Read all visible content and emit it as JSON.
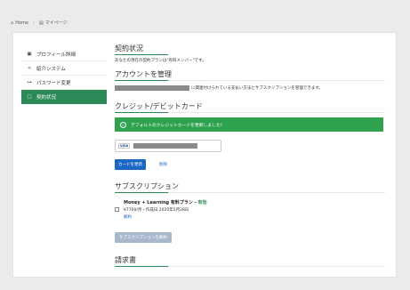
{
  "breadcrumb": {
    "home": "Home",
    "separator": "›",
    "current": "マイページ"
  },
  "sidebar": {
    "items": [
      {
        "icon": "▣",
        "label": "プロフィール詳細"
      },
      {
        "icon": "<",
        "label": "紹介システム"
      },
      {
        "icon": "⊶",
        "label": "パスワード変更"
      },
      {
        "icon": "▢",
        "label": "契約状況"
      }
    ]
  },
  "contract": {
    "title": "契約状況",
    "plan_text": "あなたの現在の契約プランは\"有料メンバー\"です。"
  },
  "account": {
    "title": "アカウントを管理",
    "description": "に関連付けられている支払い方法とサブスクリプションを管理できます。"
  },
  "credit": {
    "title": "クレジット/デビットカード",
    "alert_icon": "✓",
    "alert_text": "デフォルトのクレジットカードを更新しました！",
    "card_brand": "VISA",
    "update_button": "カードを更新",
    "delete_link": "削除"
  },
  "subscription": {
    "title": "サブスクリプション",
    "name": "Money + Learning 有料プラン",
    "status_separator": " - ",
    "status": "有効",
    "detail": "¥7700/月・作成日 2020年5月28日",
    "cancel_link": "解約",
    "cancel_button": "サブスクリプションを解約"
  },
  "invoice": {
    "title": "請求書"
  },
  "colors": {
    "accent": "#2c8a58",
    "alert": "#2fa24e",
    "primary": "#1d67c4",
    "disabled": "#a7b8cc"
  }
}
